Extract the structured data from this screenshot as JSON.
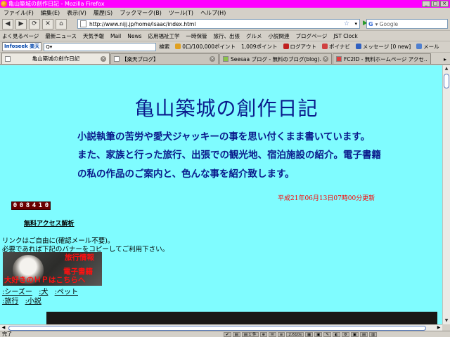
{
  "window": {
    "title": "亀山築城の創作日記 - Mozilla Firefox",
    "buttons": [
      "_",
      "□",
      "×"
    ]
  },
  "menu": [
    "ファイル(F)",
    "編集(E)",
    "表示(V)",
    "履歴(S)",
    "ブックマーク(B)",
    "ツール(T)",
    "ヘルプ(H)"
  ],
  "nav": {
    "back": "◀",
    "forward": "▶",
    "reload": "⟳",
    "stop": "✕",
    "home": "⌂",
    "url": "http://www.nijj.jp/home/isaac/index.html",
    "star": "☆",
    "dropdown": "▾",
    "go": "▶"
  },
  "search": {
    "engine": "G",
    "placeholder": "▾ Google"
  },
  "bookmarks": [
    "よく見るページ",
    "最新ニュース",
    "天気予報",
    "Mail",
    "News",
    "応用福祉工学",
    "一時保管",
    "旅行、出張",
    "グルメ",
    "小説関連",
    "ブログページ",
    "JST Clock"
  ],
  "toolbar2": {
    "logo": "Infoseek 楽天",
    "search_value": "Q▾",
    "search_btn": "検索",
    "points1": "0口/100,000ポイント",
    "points2": "1,009ポイント",
    "login": "ログアウト",
    "ponavi": "ポイナビ",
    "message": "メッセージ [0 new]",
    "mail": "メール"
  },
  "tabs": [
    {
      "label": "亀山築城の創作日記",
      "active": true
    },
    {
      "label": "【楽天ブログ】",
      "active": false
    },
    {
      "label": "Seesaa ブログ - 無料のブログ(blog)...",
      "active": false
    },
    {
      "label": "FC2ID - 無料ホームページ アクセ...",
      "active": false
    }
  ],
  "tab_close": "×",
  "tab_scroll": "▸",
  "page": {
    "title": "亀山築城の創作日記",
    "intro": [
      "小説執筆の苦労や愛犬ジャッキーの事を思い付くまま書いています。",
      "また、家族と行った旅行、出張での観光地、宿泊施設の紹介。電子書籍",
      "の私の作品のご案内と、色んな事を紹介致します。"
    ],
    "updated": "平成21年06月13日07時00分更新",
    "counter": [
      "0",
      "0",
      "8",
      "4",
      "1",
      "0"
    ],
    "access_link": "無料アクセス解析",
    "link_note": [
      "リンクはご自由に(確認メール不要)。",
      "必要であれば下記のバナーをコピーしてご利用下さい。"
    ],
    "banner": {
      "line1": "旅行情報",
      "line2": "電子書籍",
      "line3": "大好きのＨＰはこちらへ"
    },
    "categories_row1": [
      ":シーズー",
      ":犬",
      ":ペット"
    ],
    "categories_row2": [
      ":旅行",
      ":小説"
    ]
  },
  "scroll": {
    "up": "▲",
    "down": "▼",
    "left": "◀",
    "right": "▶"
  },
  "status": {
    "text": "完了",
    "addons": [
      "✔",
      "▤",
      "▤ 1 件",
      "⊕",
      "✉",
      "≡",
      "2.610s",
      "▦",
      "▣",
      "✎",
      "◐",
      "⚙",
      "▣",
      "▤",
      "▥"
    ]
  }
}
